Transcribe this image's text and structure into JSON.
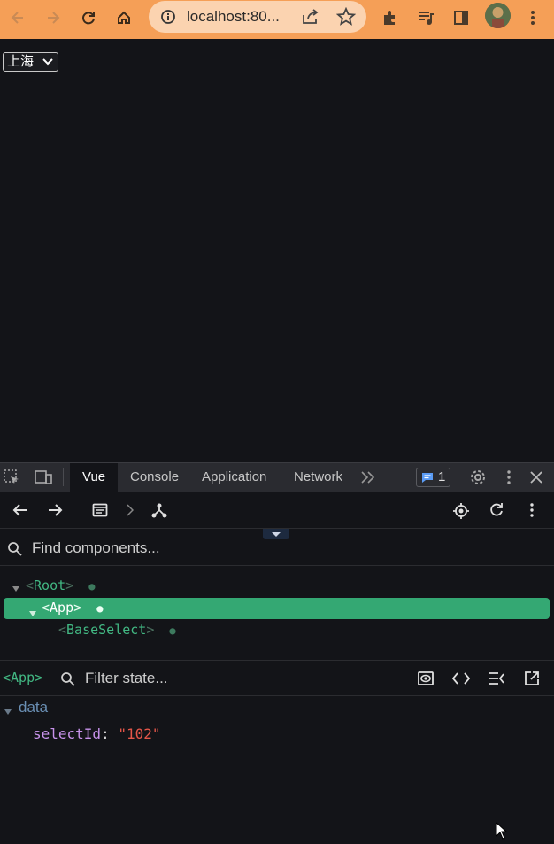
{
  "browser": {
    "url": "localhost:80...",
    "icons": [
      "back-icon",
      "forward-icon",
      "reload-icon",
      "home-icon",
      "info-icon",
      "share-icon",
      "star-icon",
      "extensions-icon",
      "media-icon",
      "sidepanel-icon",
      "avatar",
      "more-icon"
    ]
  },
  "page": {
    "select_value": "上海"
  },
  "devtools": {
    "tabs": [
      "Vue",
      "Console",
      "Application",
      "Network"
    ],
    "active_tab": "Vue",
    "message_count": "1",
    "find_placeholder": "Find components...",
    "tree": [
      {
        "name": "Root",
        "open": "<",
        "close": ">"
      },
      {
        "name": "App",
        "open": "<",
        "close": ">"
      },
      {
        "name": "BaseSelect",
        "open": "<",
        "close": ">"
      }
    ],
    "state_component": "<App>",
    "filter_placeholder": "Filter state...",
    "data_section": "data",
    "state_key": "selectId",
    "state_colon": ":",
    "state_value": "\"102\""
  },
  "colors": {
    "browser_bar": "#f59f57",
    "vue_green": "#42b883",
    "selected_row": "#34a873",
    "string_red": "#e45649"
  }
}
